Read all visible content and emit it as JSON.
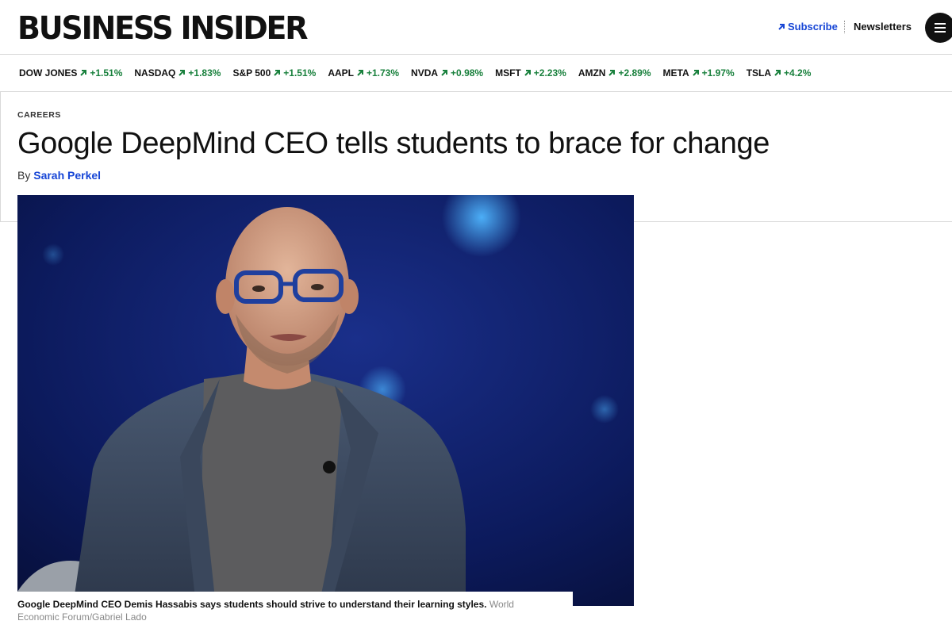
{
  "header": {
    "logo": "BUSINESS INSIDER",
    "subscribe_label": "Subscribe",
    "newsletters_label": "Newsletters"
  },
  "colors": {
    "link_blue": "#1746d6",
    "ticker_green": "#18803c",
    "photo_background": "#0b1450"
  },
  "tickers": [
    {
      "symbol": "DOW JONES",
      "change": "+1.51%"
    },
    {
      "symbol": "NASDAQ",
      "change": "+1.83%"
    },
    {
      "symbol": "S&P 500",
      "change": "+1.51%"
    },
    {
      "symbol": "AAPL",
      "change": "+1.73%"
    },
    {
      "symbol": "NVDA",
      "change": "+0.98%"
    },
    {
      "symbol": "MSFT",
      "change": "+2.23%"
    },
    {
      "symbol": "AMZN",
      "change": "+2.89%"
    },
    {
      "symbol": "META",
      "change": "+1.97%"
    },
    {
      "symbol": "TSLA",
      "change": "+4.2%"
    }
  ],
  "article": {
    "category": "CAREERS",
    "headline": "Google DeepMind CEO tells students to brace for change",
    "byline_prefix": "By",
    "author": "Sarah Perkel",
    "caption": "Google DeepMind CEO Demis Hassabis says students should strive to understand their learning styles.",
    "credit": "World Economic Forum/Gabriel Lado"
  }
}
